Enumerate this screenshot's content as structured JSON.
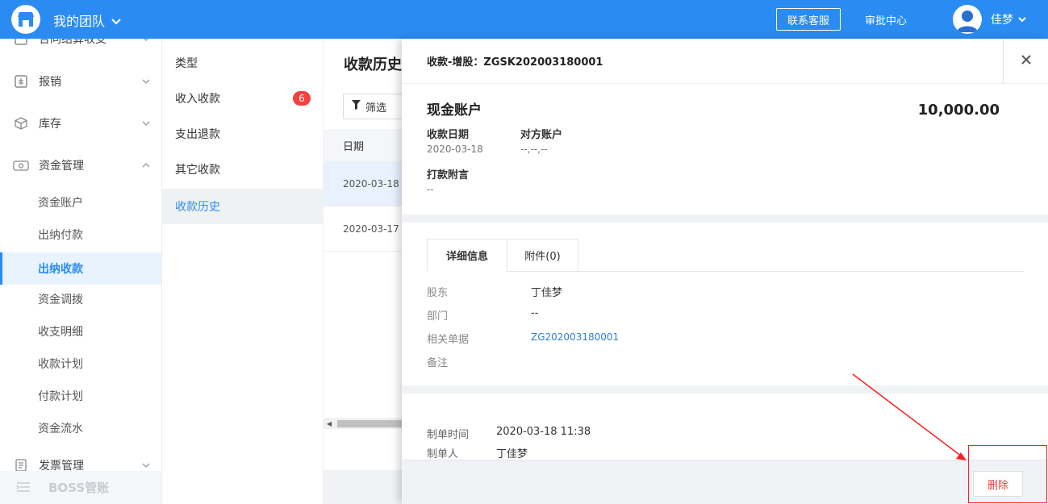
{
  "topbar": {
    "team_name": "我的团队",
    "contact_label": "联系客服",
    "approval_label": "审批中心",
    "user_name": "佳梦",
    "accent": "#2a8cf2"
  },
  "sidebar": {
    "items": [
      {
        "label": "合同结算收支",
        "icon": "contract-icon"
      },
      {
        "label": "报销",
        "icon": "reimburse-icon"
      },
      {
        "label": "库存",
        "icon": "box-icon"
      },
      {
        "label": "资金管理",
        "icon": "money-icon"
      }
    ],
    "sub_items": [
      "资金账户",
      "出纳付款",
      "出纳收款",
      "资金调拨",
      "收支明细",
      "收款计划",
      "付款计划",
      "资金流水"
    ],
    "active_sub": "出纳收款",
    "invoice_label": "发票管理",
    "boss_label": "BOSS管账"
  },
  "types": {
    "header": "类型",
    "items": [
      "收入收款",
      "支出退款",
      "其它收款",
      "收款历史"
    ],
    "badge": "6",
    "active": "收款历史"
  },
  "content": {
    "title": "收款历史",
    "filter_label": "筛选",
    "date_header": "日期",
    "rows": [
      "2020-03-18",
      "2020-03-17"
    ]
  },
  "drawer": {
    "title": "收款-增股：ZGSK202003180001",
    "account_name": "现金账户",
    "amount": "10,000.00",
    "date_label": "收款日期",
    "date_value": "2020-03-18",
    "counter_label": "对方账户",
    "counter_value": "--,--,--",
    "note_label": "打款附言",
    "note_value": "--",
    "tabs": [
      "详细信息",
      "附件(0)"
    ],
    "details": [
      {
        "label": "股东",
        "value": "丁佳梦"
      },
      {
        "label": "部门",
        "value": "--"
      },
      {
        "label": "相关单据",
        "value": "ZG202003180001"
      },
      {
        "label": "备注",
        "value": ""
      }
    ],
    "meta": [
      {
        "label": "制单时间",
        "value": "2020-03-18 11:38"
      },
      {
        "label": "制单人",
        "value": "丁佳梦"
      }
    ],
    "delete_label": "删除"
  }
}
